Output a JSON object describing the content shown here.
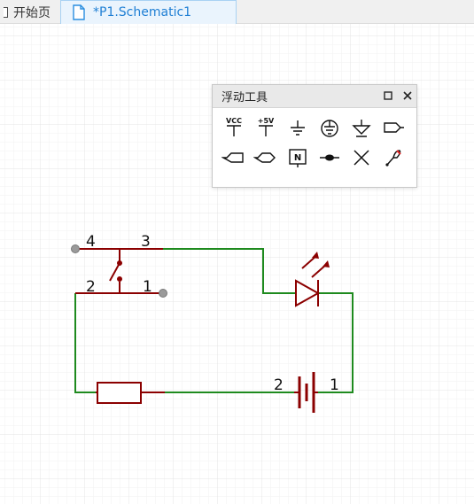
{
  "tabs": [
    {
      "label": "开始页",
      "icon": "home-icon",
      "active": false
    },
    {
      "label": "*P1.Schematic1",
      "icon": "file-icon",
      "active": true
    }
  ],
  "floating_tools": {
    "title": "浮动工具",
    "maximize_icon": "maximize-icon",
    "close_icon": "close-icon",
    "tools": [
      {
        "name": "vcc-tool",
        "label": "VCC"
      },
      {
        "name": "plus5v-tool",
        "label": "+5V"
      },
      {
        "name": "ground-tool",
        "label": ""
      },
      {
        "name": "earth-ground-tool",
        "label": ""
      },
      {
        "name": "analog-ground-tool",
        "label": ""
      },
      {
        "name": "net-port-out-tool",
        "label": ""
      },
      {
        "name": "net-port-in-tool",
        "label": ""
      },
      {
        "name": "net-port-bidir-tool",
        "label": ""
      },
      {
        "name": "net-label-tool",
        "label": "N"
      },
      {
        "name": "junction-tool",
        "label": ""
      },
      {
        "name": "no-connect-tool",
        "label": ""
      },
      {
        "name": "probe-tool",
        "label": ""
      }
    ]
  },
  "schematic": {
    "switch_pins": [
      "4",
      "3",
      "2",
      "1"
    ],
    "battery_pins": [
      "2",
      "1"
    ],
    "colors": {
      "wire": "#1e8a1e",
      "component": "#8b0000",
      "grid": "#ececec",
      "pin_end": "#8a8a8a"
    }
  }
}
